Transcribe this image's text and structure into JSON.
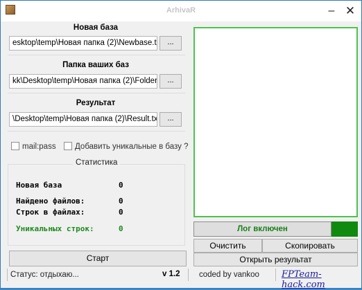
{
  "window": {
    "title": "ArhivaR",
    "minimize_glyph": "–",
    "close_glyph": "✕"
  },
  "sections": {
    "new_base": {
      "label": "Новая база",
      "path": "esktop\\temp\\Новая папка (2)\\Newbase.txt",
      "browse": "..."
    },
    "your_bases": {
      "label": "Папка ваших баз",
      "path": "kk\\Desktop\\temp\\Новая папка (2)\\Folder",
      "browse": "..."
    },
    "result": {
      "label": "Результат",
      "path": "\\Desktop\\temp\\Новая папка (2)\\Result.txt",
      "browse": "..."
    }
  },
  "options": {
    "mailpass": {
      "label": "mail:pass",
      "checked": false
    },
    "add_unique": {
      "label": "Добавить уникальные в базу ?",
      "checked": false
    }
  },
  "stats": {
    "title": "Статистика",
    "rows": [
      {
        "label": "Новая база",
        "value": "0"
      },
      {
        "label": "Найдено файлов:",
        "value": "0"
      },
      {
        "label": "Строк в файлах:",
        "value": "0"
      },
      {
        "label": "Уникальных строк:",
        "value": "0"
      }
    ]
  },
  "start_button": "Старт",
  "status": {
    "text": "Статус:  отдыхаю...",
    "version": "v 1.2"
  },
  "log": {
    "indicator_label": "Лог включен",
    "indicator_color": "#0f8a0f"
  },
  "actions": {
    "clear": "Очистить",
    "copy": "Скопировать",
    "open_result": "Открыть результат"
  },
  "footer": {
    "credit": "coded by vankoo",
    "site": "FPTeam-hack.com"
  }
}
